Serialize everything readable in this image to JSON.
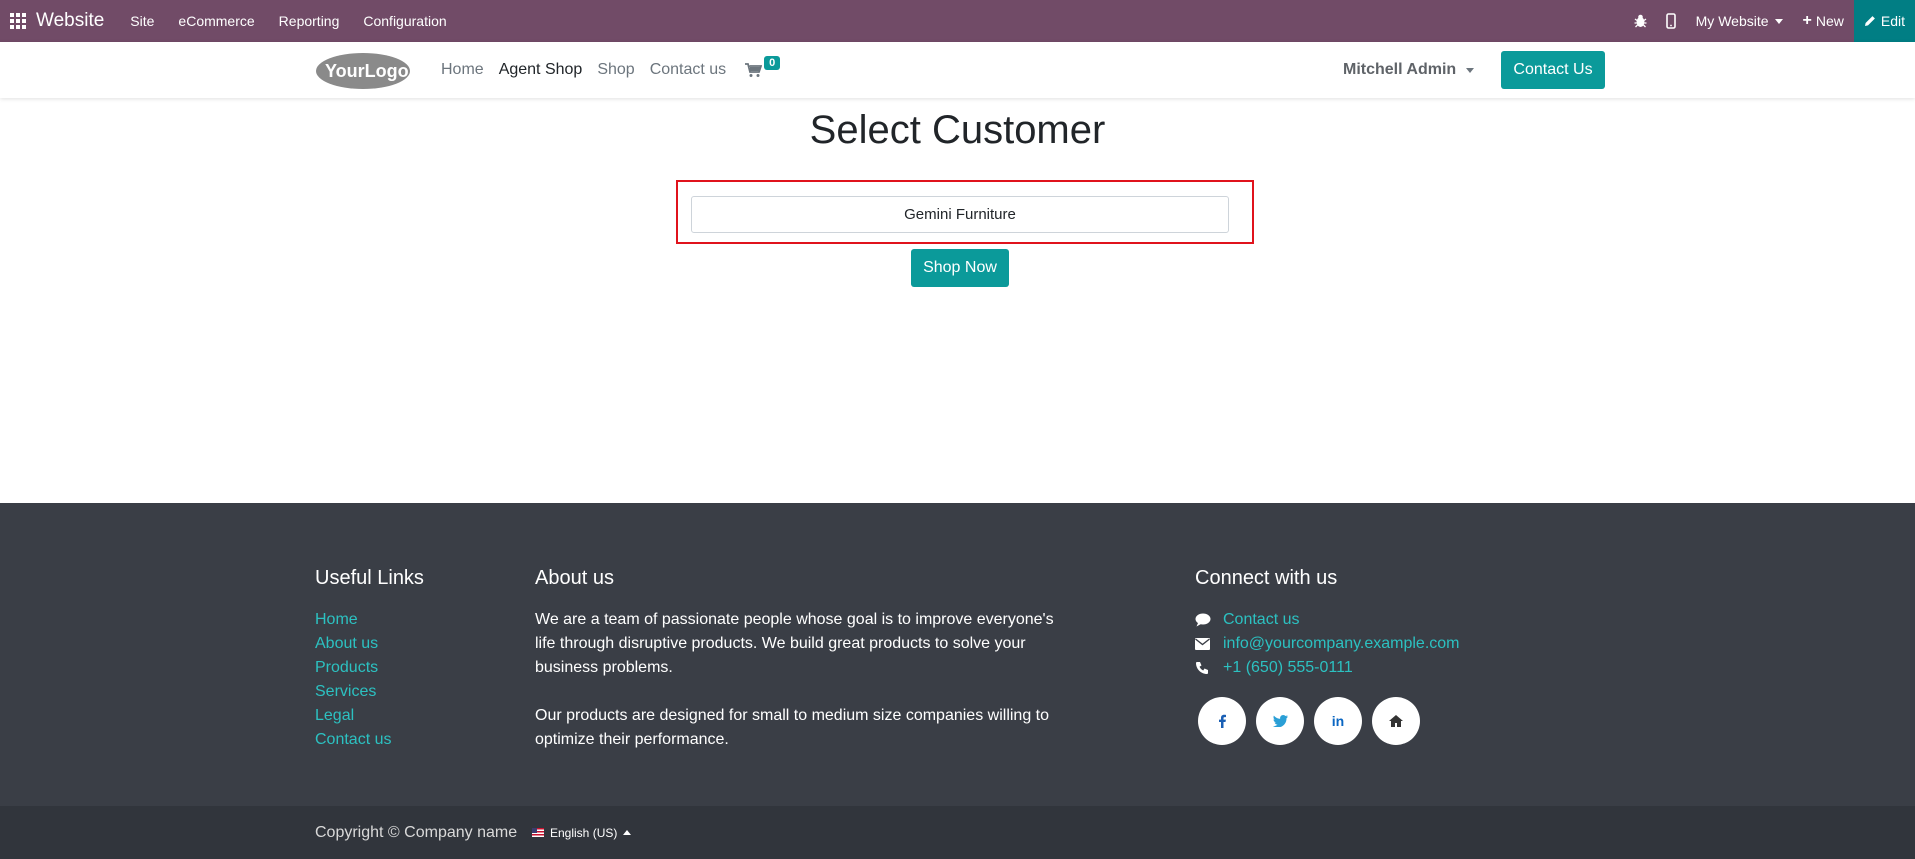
{
  "topbar": {
    "app_name": "Website",
    "menu": [
      "Site",
      "eCommerce",
      "Reporting",
      "Configuration"
    ],
    "website_selector": "My Website",
    "new_label": "New",
    "edit_label": "Edit",
    "color": "#714B67",
    "edit_color": "#017E84"
  },
  "header": {
    "logo_text": "YourLogo",
    "nav": [
      "Home",
      "Agent Shop",
      "Shop",
      "Contact us"
    ],
    "active_nav": "Agent Shop",
    "cart_count": "0",
    "user_name": "Mitchell Admin",
    "contact_button": "Contact Us"
  },
  "main": {
    "title": "Select Customer",
    "customer_value": "Gemini Furniture",
    "shop_button": "Shop Now",
    "accent_color": "#0b9a9a"
  },
  "footer": {
    "useful_links_title": "Useful Links",
    "useful_links": [
      "Home",
      "About us",
      "Products",
      "Services",
      "Legal",
      "Contact us"
    ],
    "about_title": "About us",
    "about_p1": "We are a team of passionate people whose goal is to improve everyone's life through disruptive products. We build great products to solve your business problems.",
    "about_p2": "Our products are designed for small to medium size companies willing to optimize their performance.",
    "connect_title": "Connect with us",
    "contact_link": "Contact us",
    "email": "info@yourcompany.example.com",
    "phone": "+1 (650) 555-0111",
    "socials": [
      "facebook-icon",
      "twitter-icon",
      "linkedin-icon",
      "home-icon"
    ],
    "copyright": "Copyright © Company name",
    "language": "English (US)"
  }
}
